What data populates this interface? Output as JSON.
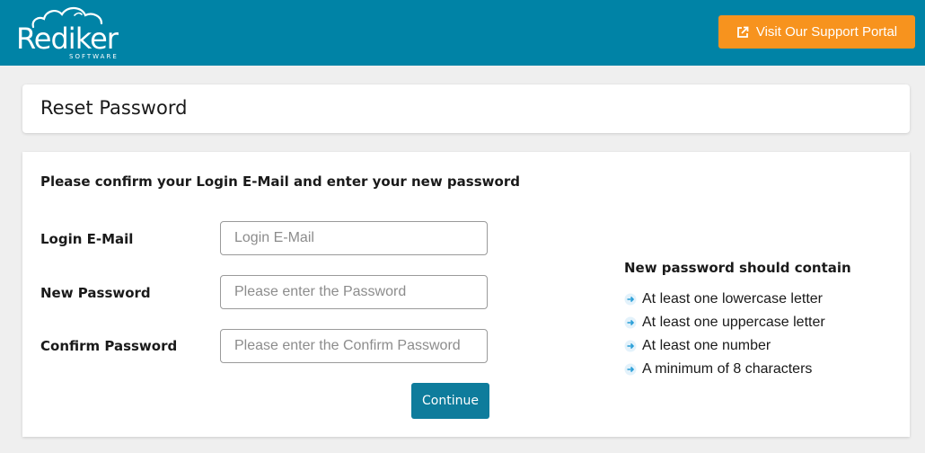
{
  "header": {
    "logo": {
      "name": "Rediker",
      "subtitle": "SOFTWARE"
    },
    "support_button": {
      "label": "Visit Our Support Portal",
      "icon": "external-link-icon"
    }
  },
  "page": {
    "title": "Reset Password"
  },
  "form": {
    "instructions": "Please confirm your Login E-Mail and enter your new password",
    "fields": [
      {
        "label": "Login E-Mail",
        "placeholder": "Login E-Mail",
        "value": ""
      },
      {
        "label": "New Password",
        "placeholder": "Please enter the Password",
        "value": ""
      },
      {
        "label": "Confirm Password",
        "placeholder": "Please enter the Confirm Password",
        "value": ""
      }
    ],
    "submit_label": "Continue"
  },
  "requirements": {
    "title": "New password should contain",
    "items": [
      "At least one lowercase letter",
      "At least one uppercase letter",
      "At least one number",
      "A minimum of 8 characters"
    ],
    "bullet_icon": "arrow-right-icon"
  },
  "colors": {
    "header_bg": "#0083a6",
    "support_button_bg": "#f7931e",
    "primary_button_bg": "#0e7c9c",
    "page_bg": "#efefef"
  }
}
